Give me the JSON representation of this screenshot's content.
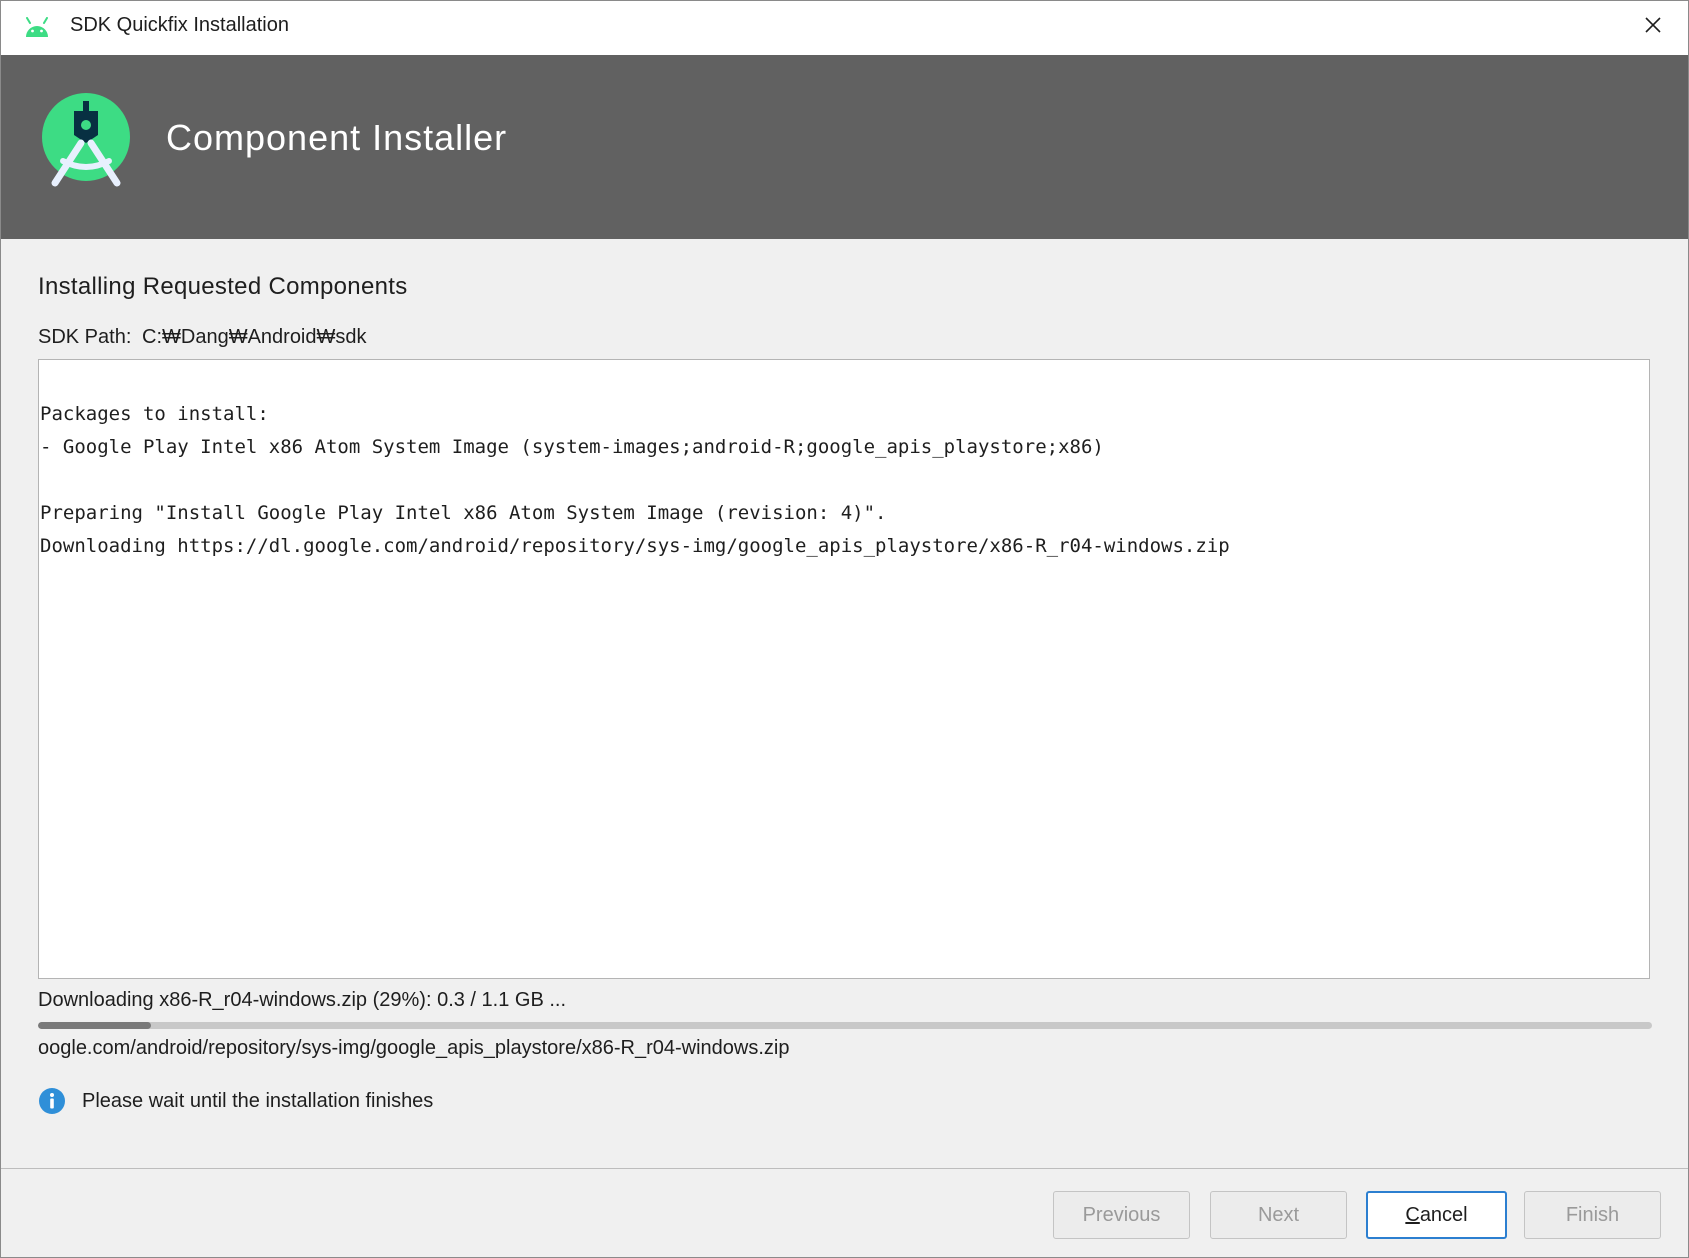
{
  "window": {
    "title": "SDK Quickfix Installation"
  },
  "banner": {
    "title": "Component Installer"
  },
  "section": {
    "title": "Installing Requested Components",
    "sdk_path_label": "SDK Path:",
    "sdk_path_value": "C:₩Dang₩Android₩sdk"
  },
  "log": {
    "lines": [
      "Packages to install:",
      "- Google Play Intel x86 Atom System Image (system-images;android-R;google_apis_playstore;x86)",
      "",
      "Preparing \"Install Google Play Intel x86 Atom System Image (revision: 4)\".",
      "Downloading https://dl.google.com/android/repository/sys-img/google_apis_playstore/x86-R_r04-windows.zip"
    ]
  },
  "progress": {
    "status_text": "Downloading x86-R_r04-windows.zip (29%): 0.3 / 1.1 GB ...",
    "fraction": 0.07,
    "url_text": "oogle.com/android/repository/sys-img/google_apis_playstore/x86-R_r04-windows.zip"
  },
  "info": {
    "icon": "info-icon",
    "message": "Please wait until the installation finishes"
  },
  "buttons": {
    "previous": "Previous",
    "next": "Next",
    "cancel_mnemonic": "C",
    "cancel_rest": "ancel",
    "finish": "Finish"
  },
  "colors": {
    "banner_bg": "#616161",
    "android_green": "#3ddc84",
    "focus_blue": "#2c7fd0",
    "info_blue": "#2f8fd8"
  }
}
